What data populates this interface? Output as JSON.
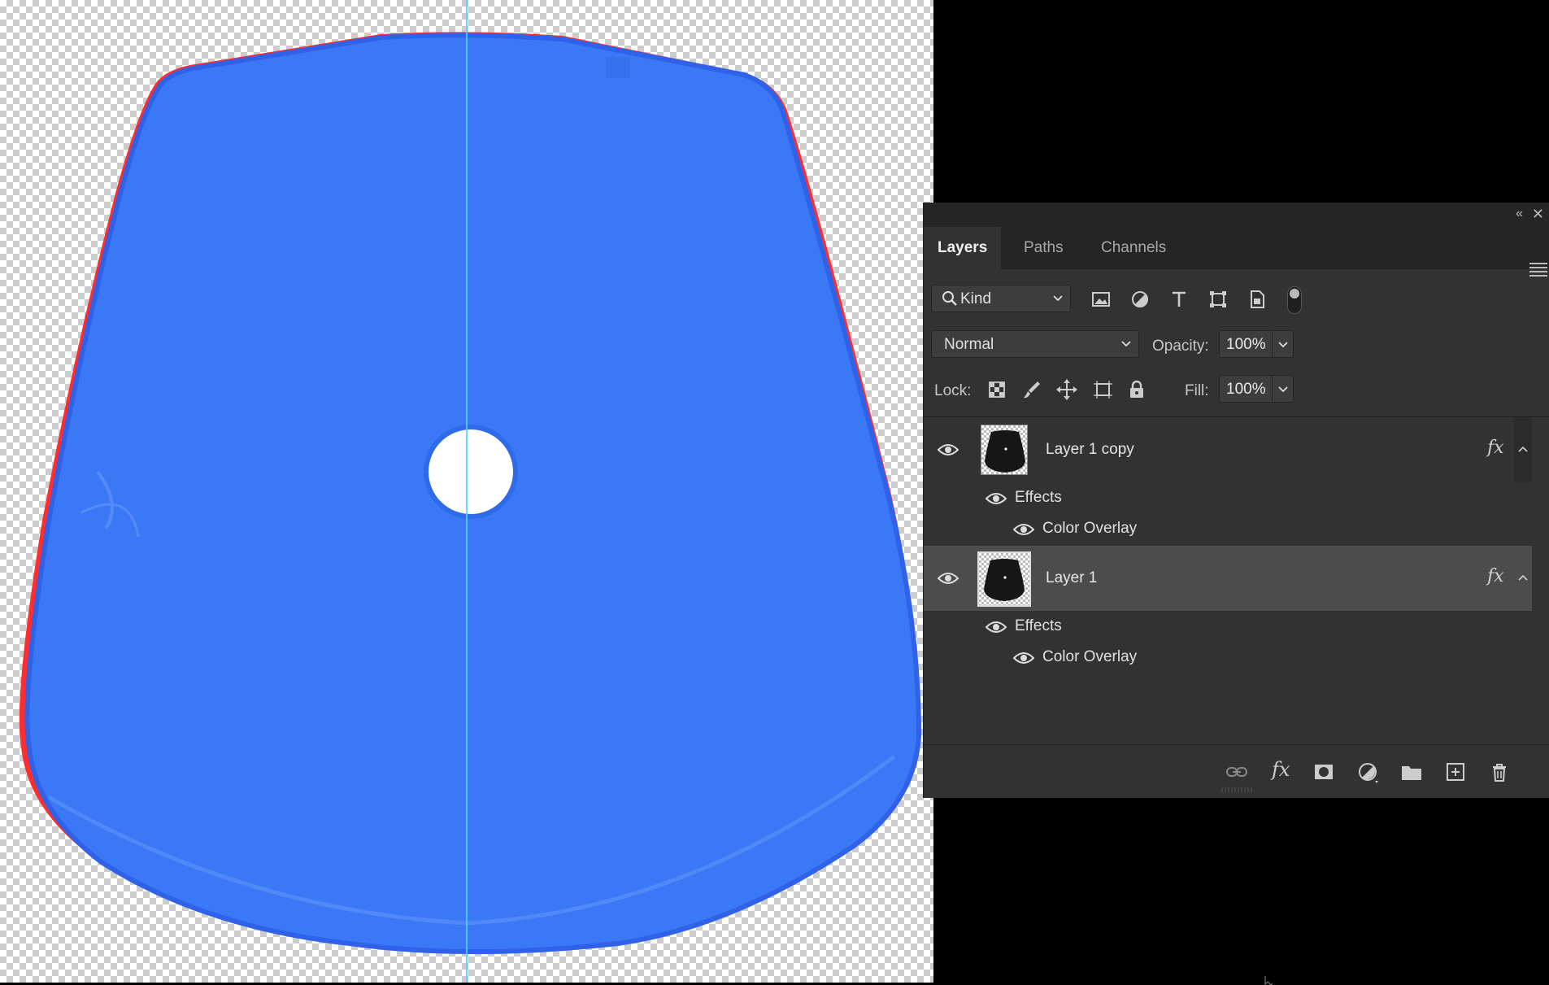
{
  "canvas": {
    "shape_fill": "#3a78f5",
    "edge_tint": "#ff2d2d",
    "guide_color": "#4fd3ff"
  },
  "panel": {
    "tabs": [
      {
        "label": "Layers",
        "active": true
      },
      {
        "label": "Paths",
        "active": false
      },
      {
        "label": "Channels",
        "active": false
      }
    ],
    "filter": {
      "kind_label": "Kind",
      "icons": [
        "image-filter-icon",
        "adjustment-filter-icon",
        "type-filter-icon",
        "shape-filter-icon",
        "smart-object-filter-icon"
      ]
    },
    "blend_mode": "Normal",
    "opacity_label": "Opacity:",
    "opacity_value": "100%",
    "lock_label": "Lock:",
    "lock_icons": [
      "lock-transparent-pixels-icon",
      "lock-image-pixels-icon",
      "lock-position-icon",
      "lock-artboard-icon",
      "lock-all-icon"
    ],
    "fill_label": "Fill:",
    "fill_value": "100%"
  },
  "layers": [
    {
      "name": "Layer 1 copy",
      "selected": false,
      "visible": true,
      "effects_label": "Effects",
      "effect_name": "Color Overlay"
    },
    {
      "name": "Layer 1",
      "selected": true,
      "visible": true,
      "effects_label": "Effects",
      "effect_name": "Color Overlay"
    }
  ],
  "footer_icons": [
    "link-layers-icon",
    "add-layer-style-icon",
    "add-mask-icon",
    "new-adjustment-layer-icon",
    "new-group-icon",
    "new-layer-icon",
    "delete-layer-icon"
  ]
}
